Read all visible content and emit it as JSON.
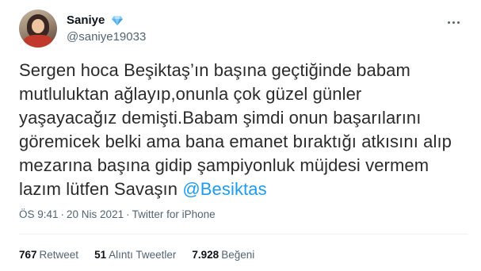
{
  "user": {
    "display_name": "Saniye",
    "badge_icon": "diamond-icon",
    "handle": "@saniye19033"
  },
  "tweet": {
    "text_lines": [
      "Sergen hoca Beşiktaş’ın başına geçtiğinde babam",
      "mutluluktan ağlayıp,onunla çok güzel günler",
      "yaşayacağız demişti.Babam  şimdi onun başarılarını",
      "göremicek belki ama bana emanet bıraktığı atkısını alıp",
      "mezarına başına gidip şampiyonluk müjdesi vermem",
      "lazım lütfen Savaşın "
    ],
    "mention": "@Besiktas"
  },
  "meta": {
    "time": "ÖS 9:41",
    "date": "20 Nis 2021",
    "source": "Twitter for iPhone",
    "separator": "·"
  },
  "stats": {
    "retweets_count": "767",
    "retweets_label": "Retweet",
    "quotes_count": "51",
    "quotes_label": "Alıntı Tweetler",
    "likes_count": "7.928",
    "likes_label": "Beğeni"
  },
  "colors": {
    "accent": "#1d9bf0",
    "secondary_text": "#536471",
    "badge": "#7ec8f5"
  }
}
